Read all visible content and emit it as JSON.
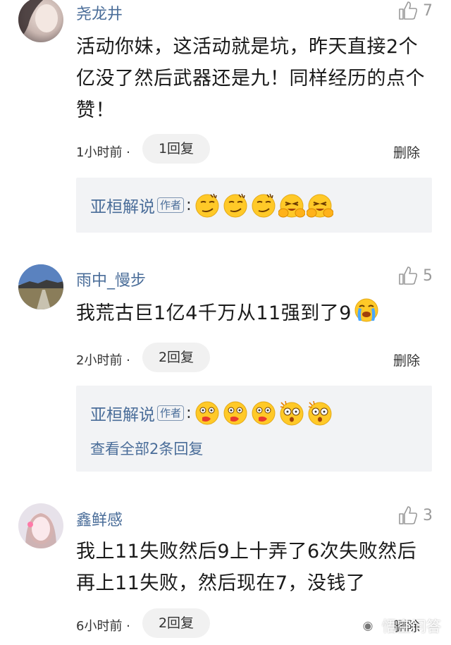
{
  "comments": [
    {
      "username": "尧龙井",
      "likes": "7",
      "text": "活动你妹，这活动就是坑，昨天直接2个亿没了然后武器还是九！同样经历的点个赞！",
      "time": "1小时前 ·",
      "reply_count": "1回复",
      "delete_label": "删除",
      "author_reply": {
        "name": "亚桓解说",
        "tag": "作者",
        "colon": ":",
        "emojis": [
          "smirk-emoji",
          "smirk-emoji",
          "smirk-emoji",
          "laugh-cover-emoji",
          "laugh-cover-emoji"
        ]
      }
    },
    {
      "username": "雨中_慢步",
      "likes": "5",
      "text": "我荒古巨1亿4千万从11强到了9",
      "time": "2小时前 ·",
      "reply_count": "2回复",
      "delete_label": "删除",
      "author_reply": {
        "name": "亚桓解说",
        "tag": "作者",
        "colon": ":",
        "emojis": [
          "vomit-emoji",
          "vomit-emoji",
          "vomit-emoji",
          "shocked-emoji",
          "shocked-emoji"
        ],
        "view_all": "查看全部2条回复"
      }
    },
    {
      "username": "鑫鲜感",
      "likes": "3",
      "text": "我上11失败然后9上十弄了6次失败然后再上11失败，然后现在7，没钱了",
      "time": "6小时前 ·",
      "reply_count": "2回复",
      "delete_label": "删除"
    }
  ],
  "watermark": {
    "logo_icon": "wukong-logo-icon",
    "text": "悟空问答"
  },
  "colors": {
    "username": "#4a6d99",
    "reply_bg": "#f2f3f5",
    "pill_bg": "#f1f1f1",
    "emoji_yellow": "#ffc928"
  }
}
